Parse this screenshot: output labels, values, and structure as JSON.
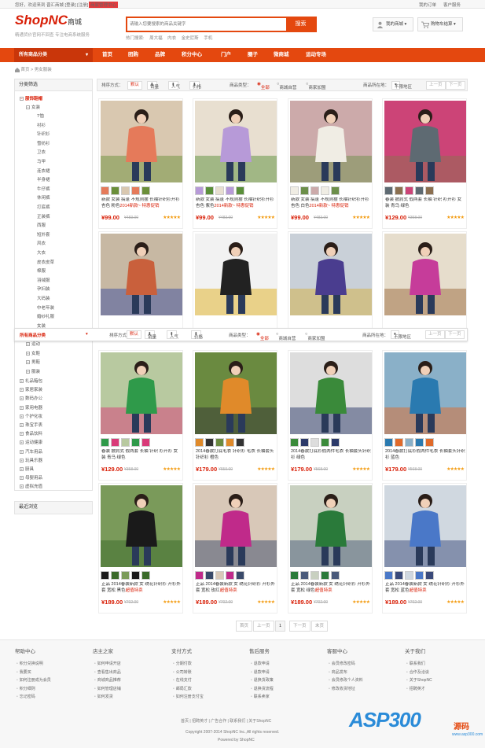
{
  "topbar": {
    "welcome": "您好，欢迎来到 晋汇商城 [登录] [注册]",
    "seller_center": "商家管理中心",
    "my_order": "我的订单",
    "customer_service": "客户服务"
  },
  "header": {
    "logo": "ShopNC",
    "logo_sub": "商城",
    "slogan": "精通货价官网不回查  专注电商系统服务",
    "search_placeholder": "请输入您要搜索的商品关键字",
    "search_button": "搜索",
    "hot_label": "热门搜索:",
    "hot_words": [
      "周大福",
      "内衣",
      "金史尼斯",
      "手机"
    ],
    "my_mall": "我的商城",
    "cart": "购物车结算"
  },
  "nav": {
    "all_categories": "所有商品分类",
    "items": [
      "首页",
      "团购",
      "品牌",
      "积分中心",
      "门户",
      "圈子",
      "微商城",
      "运动专场"
    ]
  },
  "breadcrumb": "首页 > 男女服装",
  "sidebar": {
    "title": "分类筛选",
    "main_cat": "服饰鞋帽",
    "sub1": "女装",
    "subs": [
      "T恤",
      "衬衫",
      "针织衫",
      "雪纺衫",
      "卫衣",
      "马甲",
      "连衣裙",
      "半身裙",
      "牛仔裤",
      "休闲裤",
      "打底裤",
      "正装裤",
      "西服",
      "短外套",
      "风衣",
      "大衣",
      "皮衣皮草",
      "棉服",
      "羽绒服",
      "孕妇装",
      "大码装",
      "中老年装",
      "婚纱礼服",
      "女装"
    ],
    "lower": [
      "运动",
      "女鞋",
      "男鞋",
      "服装"
    ],
    "top_cats": [
      "礼品箱包",
      "家居家装",
      "数码办公",
      "家用电器",
      "个护化妆",
      "珠宝手表",
      "食品饮料",
      "运动健康",
      "汽车用品",
      "玩具乐器",
      "厨具",
      "母婴用品",
      "虚拟充值"
    ],
    "recent": "最近浏览"
  },
  "filter": {
    "sort_label": "排序方式：",
    "sort_default": "默认",
    "sort_sales": "销量",
    "sort_pop": "人气",
    "sort_price": "价格",
    "type_label": "商品类型：",
    "type_all": "全部",
    "type_self": "商城自营",
    "type_store": "商家加盟",
    "loc_label": "商品所在地：",
    "loc_value": "不限地区",
    "prev": "上一页",
    "next": "下一页"
  },
  "floatbar": {
    "all_categories": "所有商品分类"
  },
  "products": [
    {
      "name": "新款 女装 搞蓬 不规则摆 长袖针织衫开衫 杏色 粉色",
      "promo": "2014新款~ 特惠促销",
      "price": "¥99.00",
      "old": "¥483.00",
      "stars": "★★★★★"
    },
    {
      "name": "新款 女装 搞蓬 不规则摆 长袖针织衫开衫 杏色 紫色",
      "promo": "2014新款~ 特惠促销",
      "price": "¥99.00",
      "old": "¥483.00",
      "stars": "★★★★★"
    },
    {
      "name": "新款 女装 搞蓬 不规则摆 长袖针织衫开衫 杏色 白色",
      "promo": "2014新款~ 特惠促销",
      "price": "¥99.00",
      "old": "¥483.00",
      "stars": "★★★★★"
    },
    {
      "name": "春装 披肩式 假两套 长袖 针织 衫开衫 女装 青乌 绿色",
      "promo": "",
      "price": "¥129.00",
      "old": "¥358.00",
      "stars": "★★★★★"
    },
    {
      "name": "",
      "promo": "",
      "price": "",
      "old": "",
      "stars": ""
    },
    {
      "name": "",
      "promo": "",
      "price": "",
      "old": "",
      "stars": ""
    },
    {
      "name": "",
      "promo": "",
      "price": "",
      "old": "",
      "stars": ""
    },
    {
      "name": "",
      "promo": "",
      "price": "",
      "old": "",
      "stars": ""
    },
    {
      "name": "春装 披肩式 假两套 长袖 针织 衫开衫 女装 青乌 绿色",
      "promo": "",
      "price": "¥129.00",
      "old": "¥358.00",
      "stars": "★★★★★"
    },
    {
      "name": "2014春款打底毛衣 针织衫 毛衣 长袖套头针织衫 橙色",
      "promo": "",
      "price": "¥179.00",
      "old": "¥659.00",
      "stars": "★★★★★"
    },
    {
      "name": "2014春款打底衫假两件毛衣 长袖套头针织衫 绿色",
      "promo": "",
      "price": "¥179.00",
      "old": "¥568.00",
      "stars": "★★★★★"
    },
    {
      "name": "2014春款打底衫假两件毛衣 长袖套头针织衫 蓝色",
      "promo": "",
      "price": "¥179.00",
      "old": "¥568.00",
      "stars": "★★★★★"
    },
    {
      "name": "正品 2014春装新款 女 绣花针织衫 开衫外套 宽松 黑色",
      "promo": "超值特卖",
      "price": "¥189.00",
      "old": "¥702.00",
      "stars": "★★★★★"
    },
    {
      "name": "正品 2014春装新款 女 绣花针织衫 开衫外套 宽松 玫红",
      "promo": "超值特卖",
      "price": "¥189.00",
      "old": "¥702.00",
      "stars": "★★★★★"
    },
    {
      "name": "正品 2014春装新款 女 绣花针织衫 开衫外套 宽松 绿色",
      "promo": "超值特卖",
      "price": "¥189.00",
      "old": "¥702.00",
      "stars": "★★★★★"
    },
    {
      "name": "正品 2014春装新款 女 绣花针织衫 开衫外套 宽松 蓝色",
      "promo": "超值特卖",
      "price": "¥189.00",
      "old": "¥702.00",
      "stars": "★★★★★"
    }
  ],
  "pager": {
    "first": "首页",
    "prev": "上一页",
    "current": "1",
    "next": "下一页",
    "last": "末页"
  },
  "footer": {
    "cols": [
      {
        "title": "帮助中心",
        "links": [
          "积分兑换说明",
          "我要买",
          "如何注册成为会员",
          "积分细则",
          "忘记密码"
        ]
      },
      {
        "title": "店主之家",
        "links": [
          "如何申请开店",
          "查看售出商品",
          "商城商品推荐",
          "如何管理店铺",
          "如何发货"
        ]
      },
      {
        "title": "支付方式",
        "links": [
          "分期付款",
          "公司转账",
          "在线支付",
          "邮局汇款",
          "如何注册支付宝"
        ]
      },
      {
        "title": "售后服务",
        "links": [
          "退款申请",
          "退款申请",
          "退换货政策",
          "退换货流程",
          "联系卖家"
        ]
      },
      {
        "title": "客服中心",
        "links": [
          "会员修改密码",
          "商品发布",
          "会员修改个人资料",
          "修改收货地址"
        ]
      },
      {
        "title": "关于我们",
        "links": [
          "联系我们",
          "合作及洽谈",
          "关于ShopNC",
          "招聘英才"
        ]
      }
    ],
    "bottom_links": "首页 | 招聘英才 | 广告合作 | 联系我们 | 关于ShopNC",
    "copyright": "Copyright 2007-2014 ShopNC Inc.,All rights reserved.",
    "powered": "Powered by ShopNC"
  },
  "watermark": {
    "brand": "ASP300",
    "code": "源码",
    "url": "www.asp300.com"
  }
}
